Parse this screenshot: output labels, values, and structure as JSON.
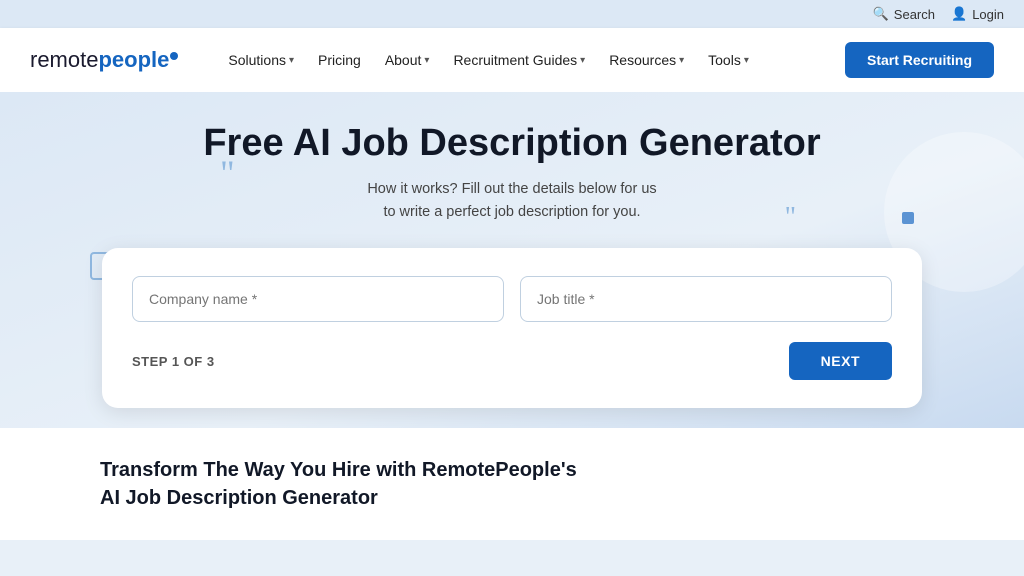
{
  "topbar": {
    "search_label": "Search",
    "login_label": "Login"
  },
  "nav": {
    "logo_remote": "remote",
    "logo_people": "people",
    "solutions_label": "Solutions",
    "pricing_label": "Pricing",
    "about_label": "About",
    "recruitment_guides_label": "Recruitment Guides",
    "resources_label": "Resources",
    "tools_label": "Tools",
    "cta_label": "Start Recruiting"
  },
  "hero": {
    "title": "Free AI Job Description Generator",
    "subtitle_line1": "How it works? Fill out the details below for us",
    "subtitle_line2": "to write a perfect job description for you."
  },
  "form": {
    "company_name_placeholder": "Company name *",
    "job_title_placeholder": "Job title *",
    "step_label": "STEP 1 OF 3",
    "next_label": "NEXT"
  },
  "bottom": {
    "title": "Transform The Way You Hire with RemotePeople's AI Job Description Generator"
  }
}
